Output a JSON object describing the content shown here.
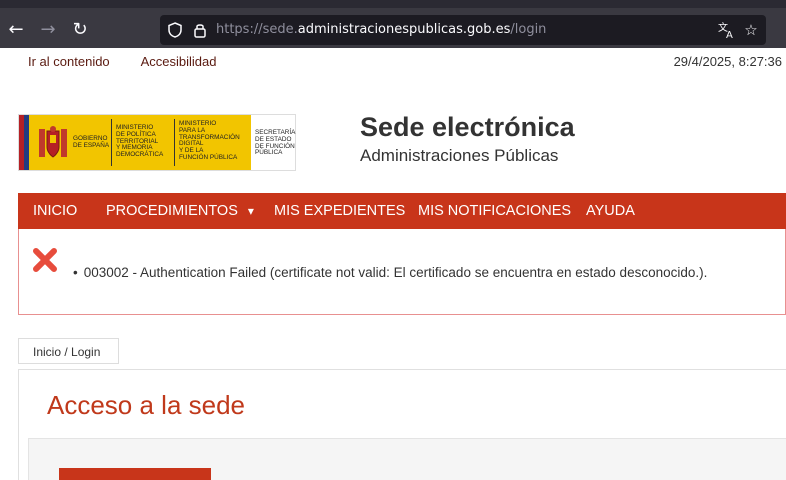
{
  "browser": {
    "url_scheme": "https://sede.",
    "url_domain": "administracionespublicas.gob.es",
    "url_path": "/login"
  },
  "page": {
    "skip_links": [
      "Ir al contenido",
      "Accesibilidad"
    ],
    "datetime": "29/4/2025, 8:27:36"
  },
  "logo": {
    "line1": [
      "GOBIERNO",
      "DE ESPAÑA"
    ],
    "line2": [
      "MINISTERIO",
      "DE POLÍTICA",
      "TERRITORIAL",
      "Y MEMORIA",
      "DEMOCRÁTICA"
    ],
    "line3": [
      "MINISTERIO",
      "PARA LA",
      "TRANSFORMACIÓN",
      "DIGITAL",
      "Y DE LA",
      "FUNCIÓN PÚBLICA"
    ],
    "line4": [
      "SECRETARÍA",
      "DE ESTADO",
      "DE FUNCIÓN",
      "PÚBLICA"
    ]
  },
  "header": {
    "title": "Sede electrónica",
    "subtitle": "Administraciones Públicas"
  },
  "nav": {
    "items": [
      "INICIO",
      "PROCEDIMIENTOS",
      "MIS EXPEDIENTES",
      "MIS NOTIFICACIONES",
      "AYUDA"
    ],
    "dropdown_glyph": "▾"
  },
  "error": {
    "message": "003002 - Authentication Failed (certificate not valid: El certificado se encuentra en estado desconocido.)."
  },
  "breadcrumb": {
    "text": "Inicio / Login"
  },
  "main": {
    "heading": "Acceso a la sede"
  },
  "colors": {
    "accent": "#c8351a",
    "heading": "#c0391b",
    "error_icon": "#e74c3c"
  }
}
